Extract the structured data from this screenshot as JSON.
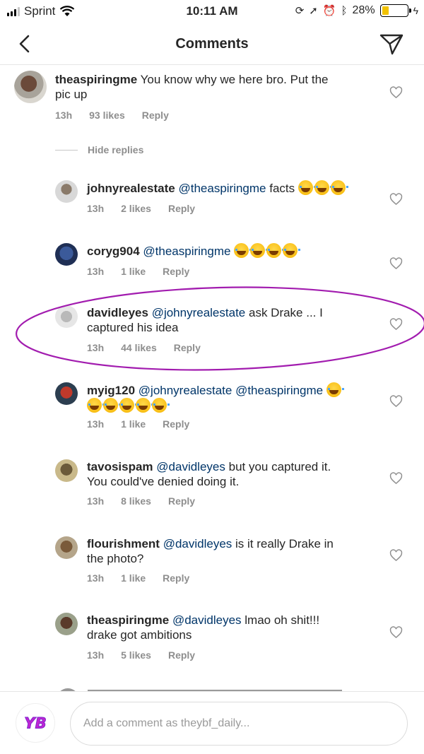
{
  "status_bar": {
    "carrier": "Sprint",
    "time": "10:11 AM",
    "battery": "28%",
    "battery_level": 0.28,
    "battery_color": "#f2c200"
  },
  "header": {
    "title": "Comments",
    "back_icon": "chevron-left-icon",
    "send_icon": "paper-plane-icon"
  },
  "hide_replies": "Hide replies",
  "colors": {
    "mention": "#003569",
    "meta": "#8e8e8e",
    "highlight": "#a21caf"
  },
  "comments": [
    {
      "username": "theaspiringme",
      "mentions": [],
      "text": "You know why we here bro. Put the",
      "text2": "pic up",
      "time": "13h",
      "likes": "93 likes",
      "reply": "Reply"
    },
    {
      "username": "johnyrealestate",
      "mentions": [
        "@theaspiringme"
      ],
      "text": "facts",
      "emoji_count": 3,
      "time": "13h",
      "likes": "2 likes",
      "reply": "Reply"
    },
    {
      "username": "coryg904",
      "mentions": [
        "@theaspiringme"
      ],
      "emoji_count": 4,
      "time": "13h",
      "likes": "1 like",
      "reply": "Reply"
    },
    {
      "username": "davidleyes",
      "mentions": [
        "@johnyrealestate"
      ],
      "text": "ask Drake ... I",
      "text2": "captured his idea",
      "time": "13h",
      "likes": "44 likes",
      "reply": "Reply",
      "highlighted": true
    },
    {
      "username": "myig120",
      "mentions": [
        "@johnyrealestate",
        "@theaspiringme"
      ],
      "emoji_count": 1,
      "emoji_count_line2": 5,
      "time": "13h",
      "likes": "1 like",
      "reply": "Reply"
    },
    {
      "username": "tavosispam",
      "mentions": [
        "@davidleyes"
      ],
      "text": "but you captured it.",
      "text2": "You could've denied doing it.",
      "time": "13h",
      "likes": "8 likes",
      "reply": "Reply"
    },
    {
      "username": "flourishment",
      "mentions": [
        "@davidleyes"
      ],
      "text": "is it really Drake in",
      "text2": "the photo?",
      "time": "13h",
      "likes": "1 like",
      "reply": "Reply"
    },
    {
      "username": "theaspiringme",
      "mentions": [
        "@davidleyes"
      ],
      "text": "lmao oh shit!!!",
      "text2": "drake got ambitions",
      "time": "13h",
      "likes": "5 likes",
      "reply": "Reply"
    }
  ],
  "composer": {
    "placeholder": "Add a comment as theybf_daily..."
  }
}
